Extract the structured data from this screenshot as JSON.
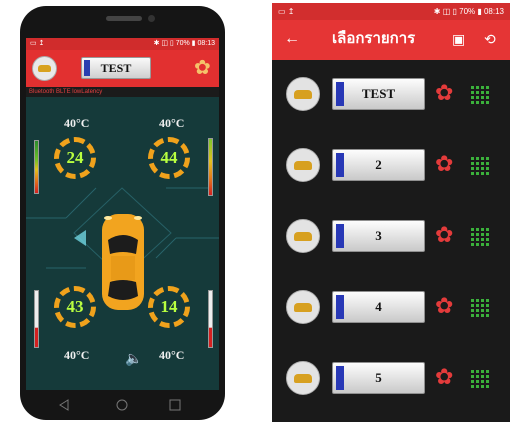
{
  "phone": {
    "status_left": "▭ ↥",
    "status_right": "✱ ◫ ▯ 70% ▮ 08:13",
    "device_name": "TEST",
    "bt_status": "Bluetooth BLTE lowLatency",
    "wheels": [
      {
        "pos": "front-left",
        "temp": "40°C",
        "value": "24"
      },
      {
        "pos": "front-right",
        "temp": "40°C",
        "value": "44"
      },
      {
        "pos": "rear-left",
        "temp": "40°C",
        "value": "43"
      },
      {
        "pos": "rear-right",
        "temp": "40°C",
        "value": "14"
      }
    ],
    "icons": {
      "logo": "car-logo-icon",
      "settings": "gear-icon",
      "sound": "speaker-icon"
    }
  },
  "list_screen": {
    "status_left": "▭ ↥",
    "status_right": "✱ ◫ ▯ 70% ▮ 08:13",
    "title": "เลือกรายการ",
    "back_icon": "←",
    "save_icon": "▣",
    "history_icon": "⟲",
    "items": [
      {
        "label": "TEST"
      },
      {
        "label": "2"
      },
      {
        "label": "3"
      },
      {
        "label": "4"
      },
      {
        "label": "5"
      }
    ],
    "colors": {
      "accent": "#e53535",
      "gear": "#e43b3b",
      "qr": "#3bb13b"
    }
  }
}
